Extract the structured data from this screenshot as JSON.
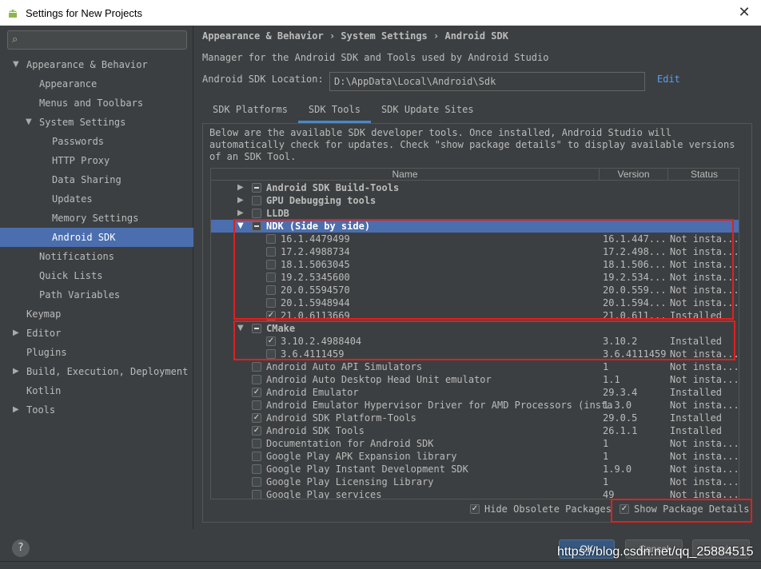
{
  "window": {
    "title": "Settings for New Projects"
  },
  "sidebar": {
    "items": [
      {
        "label": "Appearance & Behavior",
        "level": 0,
        "expanded": true,
        "bold": true
      },
      {
        "label": "Appearance",
        "level": 1
      },
      {
        "label": "Menus and Toolbars",
        "level": 1
      },
      {
        "label": "System Settings",
        "level": 1,
        "expanded": true
      },
      {
        "label": "Passwords",
        "level": 2
      },
      {
        "label": "HTTP Proxy",
        "level": 2
      },
      {
        "label": "Data Sharing",
        "level": 2
      },
      {
        "label": "Updates",
        "level": 2
      },
      {
        "label": "Memory Settings",
        "level": 2
      },
      {
        "label": "Android SDK",
        "level": 2,
        "selected": true
      },
      {
        "label": "Notifications",
        "level": 1
      },
      {
        "label": "Quick Lists",
        "level": 1
      },
      {
        "label": "Path Variables",
        "level": 1
      },
      {
        "label": "Keymap",
        "level": 0
      },
      {
        "label": "Editor",
        "level": 0,
        "collapsed": true
      },
      {
        "label": "Plugins",
        "level": 0
      },
      {
        "label": "Build, Execution, Deployment",
        "level": 0,
        "collapsed": true
      },
      {
        "label": "Kotlin",
        "level": 0
      },
      {
        "label": "Tools",
        "level": 0,
        "collapsed": true
      }
    ]
  },
  "main": {
    "breadcrumb": [
      "Appearance & Behavior",
      "System Settings",
      "Android SDK"
    ],
    "description": "Manager for the Android SDK and Tools used by Android Studio",
    "location_label": "Android SDK Location:",
    "location_value": "D:\\AppData\\Local\\Android\\Sdk",
    "edit_label": "Edit",
    "tabs": [
      {
        "label": "SDK Platforms"
      },
      {
        "label": "SDK Tools",
        "active": true
      },
      {
        "label": "SDK Update Sites"
      }
    ],
    "panel_description": "Below are the available SDK developer tools. Once installed, Android Studio will automatically check for updates. Check \"show package details\" to display available versions of an SDK Tool.",
    "columns": {
      "name": "Name",
      "version": "Version",
      "status": "Status"
    },
    "rows": [
      {
        "name": "Android SDK Build-Tools",
        "level": 0,
        "arrow": "right",
        "check": "partial",
        "bold": true,
        "version": "",
        "status": ""
      },
      {
        "name": "GPU Debugging tools",
        "level": 0,
        "arrow": "right",
        "check": "none",
        "bold": true,
        "version": "",
        "status": ""
      },
      {
        "name": "LLDB",
        "level": 0,
        "arrow": "right",
        "check": "none",
        "bold": true,
        "version": "",
        "status": ""
      },
      {
        "name": "NDK (Side by side)",
        "level": 0,
        "arrow": "down",
        "check": "partial",
        "bold": true,
        "selected": true,
        "version": "",
        "status": ""
      },
      {
        "name": "16.1.4479499",
        "level": 1,
        "check": "none",
        "version": "16.1.447...",
        "status": "Not insta..."
      },
      {
        "name": "17.2.4988734",
        "level": 1,
        "check": "none",
        "version": "17.2.498...",
        "status": "Not insta..."
      },
      {
        "name": "18.1.5063045",
        "level": 1,
        "check": "none",
        "version": "18.1.506...",
        "status": "Not insta..."
      },
      {
        "name": "19.2.5345600",
        "level": 1,
        "check": "none",
        "version": "19.2.534...",
        "status": "Not insta..."
      },
      {
        "name": "20.0.5594570",
        "level": 1,
        "check": "none",
        "version": "20.0.559...",
        "status": "Not insta..."
      },
      {
        "name": "20.1.5948944",
        "level": 1,
        "check": "none",
        "version": "20.1.594...",
        "status": "Not insta..."
      },
      {
        "name": "21.0.6113669",
        "level": 1,
        "check": "checked",
        "version": "21.0.611...",
        "status": "Installed"
      },
      {
        "name": "CMake",
        "level": 0,
        "arrow": "down",
        "check": "partial",
        "bold": true,
        "version": "",
        "status": ""
      },
      {
        "name": "3.10.2.4988404",
        "level": 1,
        "check": "checked",
        "version": "3.10.2",
        "status": "Installed"
      },
      {
        "name": "3.6.4111459",
        "level": 1,
        "check": "none",
        "version": "3.6.4111459",
        "status": "Not insta..."
      },
      {
        "name": "Android Auto API Simulators",
        "level": 0,
        "check": "none",
        "version": "1",
        "status": "Not insta..."
      },
      {
        "name": "Android Auto Desktop Head Unit emulator",
        "level": 0,
        "check": "none",
        "version": "1.1",
        "status": "Not insta..."
      },
      {
        "name": "Android Emulator",
        "level": 0,
        "check": "checked",
        "version": "29.3.4",
        "status": "Installed"
      },
      {
        "name": "Android Emulator Hypervisor Driver for AMD Processors (insta",
        "level": 0,
        "check": "none",
        "version": "1.3.0",
        "status": "Not insta..."
      },
      {
        "name": "Android SDK Platform-Tools",
        "level": 0,
        "check": "checked",
        "version": "29.0.5",
        "status": "Installed"
      },
      {
        "name": "Android SDK Tools",
        "level": 0,
        "check": "checked",
        "version": "26.1.1",
        "status": "Installed"
      },
      {
        "name": "Documentation for Android SDK",
        "level": 0,
        "check": "none",
        "version": "1",
        "status": "Not insta..."
      },
      {
        "name": "Google Play APK Expansion library",
        "level": 0,
        "check": "none",
        "version": "1",
        "status": "Not insta..."
      },
      {
        "name": "Google Play Instant Development SDK",
        "level": 0,
        "check": "none",
        "version": "1.9.0",
        "status": "Not insta..."
      },
      {
        "name": "Google Play Licensing Library",
        "level": 0,
        "check": "none",
        "version": "1",
        "status": "Not insta..."
      },
      {
        "name": "Google Play services",
        "level": 0,
        "check": "none",
        "version": "49",
        "status": "Not insta..."
      }
    ],
    "hide_obsolete_label": "Hide Obsolete Packages",
    "show_details_label": "Show Package Details"
  },
  "footer": {
    "help": "?",
    "ok": "OK",
    "cancel": "Cancel",
    "apply": "Apply"
  },
  "watermark": "https://blog.csdn.net/qq_25884515",
  "colors": {
    "selection": "#4b6eaf",
    "link": "#589df6",
    "annotation": "#e02020"
  }
}
